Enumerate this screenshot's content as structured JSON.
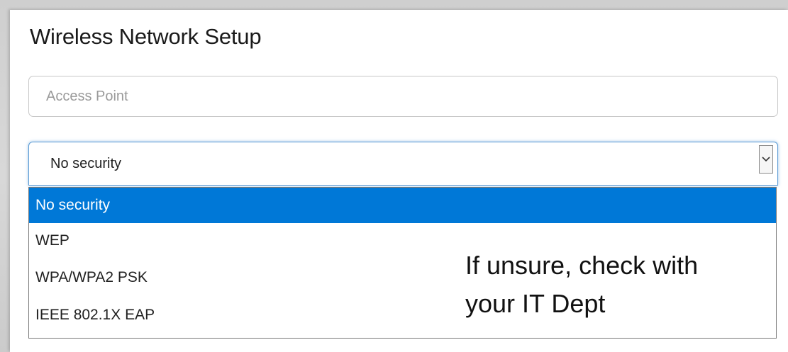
{
  "title": "Wireless Network Setup",
  "access_point": {
    "value": "",
    "placeholder": "Access Point"
  },
  "security": {
    "selected": "No security",
    "options": [
      "No security",
      "WEP",
      "WPA/WPA2 PSK",
      "IEEE 802.1X EAP"
    ],
    "highlighted_index": 0
  },
  "note": {
    "line1": "If unsure, check with",
    "line2": "your IT Dept"
  },
  "colors": {
    "highlight": "#0078d7",
    "focus_border": "#5b9bd5"
  },
  "icons": {
    "dropdown": "chevron-down-icon"
  }
}
